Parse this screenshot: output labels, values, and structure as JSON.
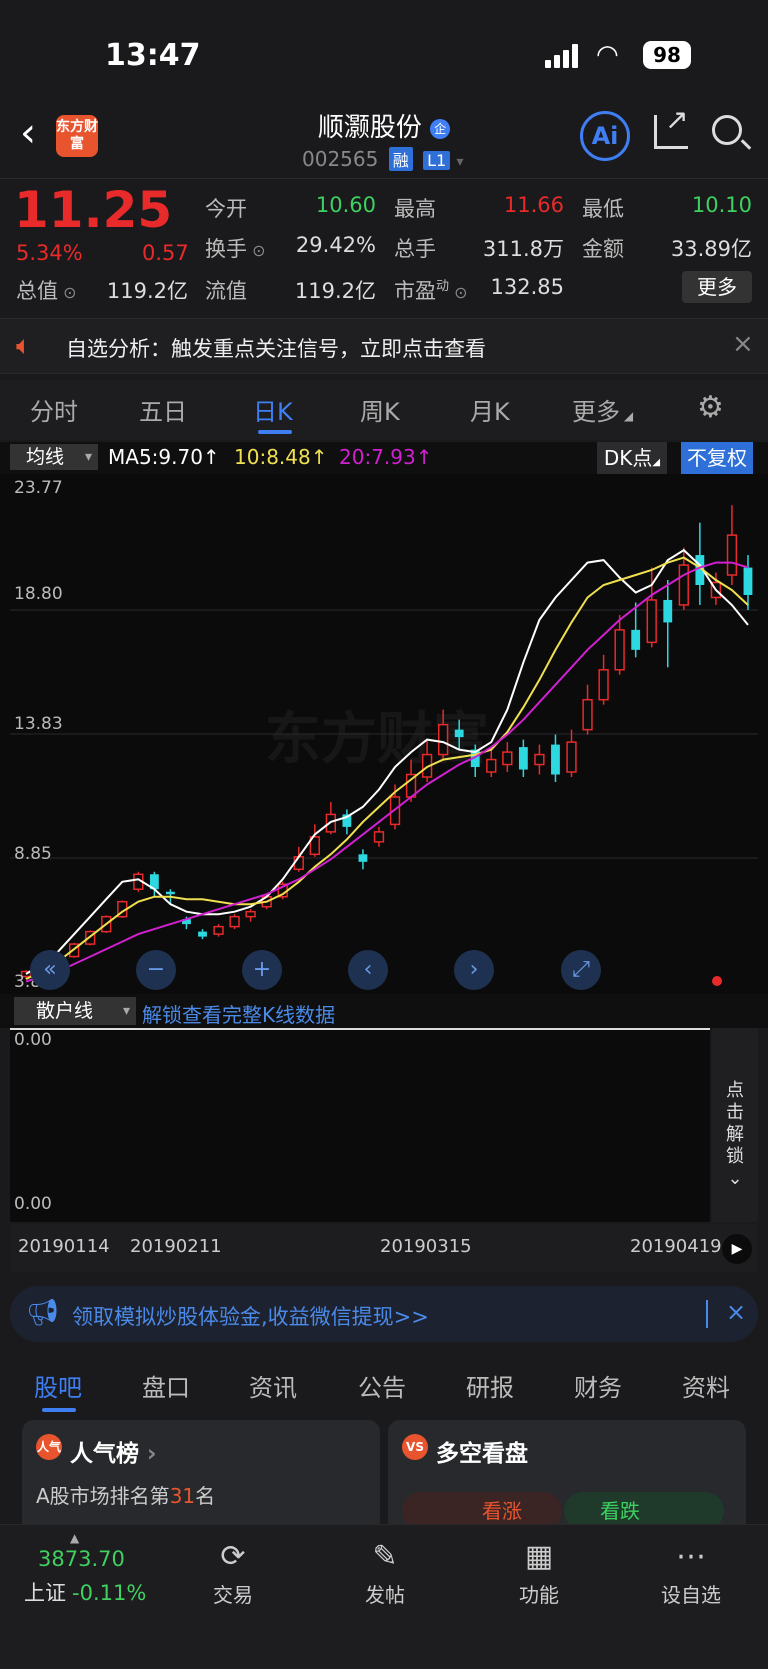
{
  "status_bar": {
    "time": "13:47",
    "battery": "98"
  },
  "header": {
    "logo_text": "东方财富",
    "stock_name": "顺灏股份",
    "name_tag": "企",
    "stock_code": "002565",
    "badge_rong": "融",
    "badge_level": "L1",
    "ai_label": "Ai"
  },
  "quote": {
    "price": "11.25",
    "change_pct": "5.34%",
    "change": "0.57",
    "open_label": "今开",
    "open": "10.60",
    "high_label": "最高",
    "high": "11.66",
    "low_label": "最低",
    "low": "10.10",
    "turnover_label": "换手",
    "turnover": "29.42%",
    "volume_label": "总手",
    "volume": "311.8万",
    "amount_label": "金额",
    "amount": "33.89亿",
    "mktcap_label": "总值",
    "mktcap": "119.2亿",
    "float_label": "流值",
    "float_cap": "119.2亿",
    "pe_label": "市盈",
    "pe_sup": "动",
    "pe": "132.85",
    "more_label": "更多"
  },
  "notice": {
    "text": "自选分析：触发重点关注信号，立即点击查看",
    "close": "×"
  },
  "period_tabs": [
    "分时",
    "五日",
    "日K",
    "周K",
    "月K",
    "更多"
  ],
  "ma_bar": {
    "selector": "均线",
    "ma5": "MA5:9.70↑",
    "ma10": "10:8.48↑",
    "ma20": "20:7.93↑",
    "dk_label": "DK点",
    "fq_label": "不复权"
  },
  "colors": {
    "up": "#e82a2a",
    "down": "#2ed8e0",
    "ma5": "#ffffff",
    "ma10": "#f0e050",
    "ma20": "#d020d0",
    "accent": "#3f7ef3"
  },
  "chart_data": {
    "type": "candlestick",
    "y_ticks": [
      "23.77",
      "18.80",
      "13.83",
      "8.85",
      "3.88"
    ],
    "ylim": [
      3.88,
      23.77
    ],
    "x_ticks": [
      "20190114",
      "20190211",
      "20190315",
      "20190419"
    ],
    "watermark": "东方财富",
    "series": [
      {
        "name": "MA5",
        "values": [
          4.2,
          4.6,
          5.1,
          5.8,
          6.5,
          7.2,
          7.9,
          8.0,
          7.6,
          7.0,
          6.7,
          6.6,
          6.6,
          6.7,
          6.9,
          7.3,
          8.0,
          8.9,
          9.8,
          10.3,
          10.5,
          10.9,
          11.6,
          12.5,
          13.1,
          13.6,
          13.5,
          13.2,
          13.1,
          13.5,
          14.8,
          16.7,
          18.4,
          19.3,
          20.0,
          20.7,
          20.8,
          20.1,
          19.5,
          19.8,
          20.8,
          21.2,
          20.6,
          19.6,
          19.0,
          18.2
        ]
      },
      {
        "name": "MA10",
        "values": [
          4.0,
          4.3,
          4.7,
          5.2,
          5.7,
          6.2,
          6.7,
          7.1,
          7.3,
          7.3,
          7.2,
          7.2,
          7.1,
          7.0,
          7.0,
          7.1,
          7.4,
          7.9,
          8.5,
          9.0,
          9.6,
          10.3,
          10.9,
          11.5,
          12.0,
          12.5,
          12.8,
          12.9,
          13.0,
          13.2,
          13.9,
          14.9,
          16.0,
          17.2,
          18.3,
          19.3,
          19.8,
          20.0,
          20.2,
          20.4,
          20.7,
          20.9,
          20.5,
          20.0,
          19.6,
          19.0
        ]
      },
      {
        "name": "MA20",
        "values": [
          3.9,
          4.1,
          4.3,
          4.6,
          4.9,
          5.2,
          5.5,
          5.8,
          6.0,
          6.2,
          6.4,
          6.6,
          6.8,
          7.0,
          7.2,
          7.4,
          7.7,
          8.0,
          8.4,
          8.8,
          9.3,
          9.8,
          10.3,
          10.8,
          11.3,
          11.8,
          12.2,
          12.6,
          12.9,
          13.3,
          13.8,
          14.4,
          15.1,
          15.8,
          16.5,
          17.2,
          17.8,
          18.4,
          18.9,
          19.4,
          19.8,
          20.2,
          20.5,
          20.7,
          20.7,
          20.5
        ]
      }
    ],
    "candles": [
      [
        4.1,
        4.3,
        4.0,
        4.35
      ],
      [
        4.3,
        4.5,
        4.25,
        4.55
      ],
      [
        4.5,
        4.9,
        4.45,
        4.95
      ],
      [
        4.9,
        5.4,
        4.85,
        5.45
      ],
      [
        5.4,
        5.9,
        5.35,
        5.95
      ],
      [
        5.9,
        6.5,
        5.85,
        6.55
      ],
      [
        6.5,
        7.1,
        6.45,
        7.15
      ],
      [
        7.6,
        8.2,
        7.5,
        8.3
      ],
      [
        8.2,
        7.6,
        7.3,
        8.3
      ],
      [
        7.5,
        7.4,
        7.0,
        7.6
      ],
      [
        6.4,
        6.2,
        6.0,
        6.5
      ],
      [
        5.9,
        5.7,
        5.6,
        6.0
      ],
      [
        5.8,
        6.1,
        5.7,
        6.2
      ],
      [
        6.1,
        6.5,
        6.0,
        6.6
      ],
      [
        6.5,
        6.7,
        6.3,
        6.8
      ],
      [
        6.9,
        7.3,
        6.8,
        7.4
      ],
      [
        7.3,
        7.8,
        7.2,
        7.9
      ],
      [
        8.4,
        8.9,
        8.3,
        9.3
      ],
      [
        9.0,
        9.7,
        8.9,
        10.2
      ],
      [
        9.9,
        10.6,
        9.8,
        11.1
      ],
      [
        10.6,
        10.1,
        9.8,
        10.8
      ],
      [
        9.0,
        8.7,
        8.4,
        9.2
      ],
      [
        9.5,
        9.9,
        9.3,
        10.1
      ],
      [
        10.2,
        11.3,
        10.0,
        11.8
      ],
      [
        11.3,
        12.2,
        11.1,
        12.8
      ],
      [
        12.1,
        13.0,
        11.9,
        13.6
      ],
      [
        13.0,
        14.2,
        12.8,
        14.8
      ],
      [
        14.0,
        13.7,
        13.2,
        14.4
      ],
      [
        13.2,
        12.5,
        12.1,
        13.4
      ],
      [
        12.3,
        12.8,
        12.1,
        13.2
      ],
      [
        12.6,
        13.1,
        12.3,
        13.5
      ],
      [
        13.3,
        12.4,
        12.1,
        13.6
      ],
      [
        12.6,
        13.0,
        12.2,
        13.4
      ],
      [
        13.4,
        12.2,
        11.9,
        13.8
      ],
      [
        12.3,
        13.5,
        12.1,
        14.0
      ],
      [
        14.0,
        15.2,
        13.8,
        15.8
      ],
      [
        15.2,
        16.4,
        15.0,
        17.0
      ],
      [
        16.4,
        18.0,
        16.2,
        18.6
      ],
      [
        18.0,
        17.2,
        16.9,
        19.1
      ],
      [
        17.5,
        19.2,
        17.3,
        20.5
      ],
      [
        19.2,
        18.3,
        16.5,
        20.0
      ],
      [
        19.0,
        20.6,
        18.8,
        21.3
      ],
      [
        21.0,
        19.8,
        19.0,
        22.3
      ],
      [
        19.3,
        19.9,
        19.0,
        20.3
      ],
      [
        20.2,
        21.8,
        19.8,
        23.0
      ],
      [
        20.5,
        19.4,
        18.8,
        21.0
      ]
    ]
  },
  "sub_indicator": {
    "selector": "散户线",
    "unlock_link": "解锁查看完整K线数据",
    "top_value": "0.00",
    "bottom_value": "0.00",
    "side_unlock": "点击解锁"
  },
  "promo": {
    "text": "领取模拟炒股体验金,收益微信提现>>",
    "close": "×"
  },
  "bottom_tabs": [
    "股吧",
    "盘口",
    "资讯",
    "公告",
    "研报",
    "财务",
    "资料"
  ],
  "cards": {
    "popularity": {
      "icon": "人气",
      "title": "人气榜",
      "rank_prefix": "A股市场排名第",
      "rank": "31",
      "rank_suffix": "名"
    },
    "bull_bear": {
      "icon": "VS",
      "title": "多空看盘",
      "bull": "看涨",
      "bear": "看跌"
    }
  },
  "bottom_nav": {
    "index_value": "3873.70",
    "index_name": "上证",
    "index_change": "-0.11%",
    "items": [
      "交易",
      "发帖",
      "功能",
      "设自选"
    ]
  }
}
